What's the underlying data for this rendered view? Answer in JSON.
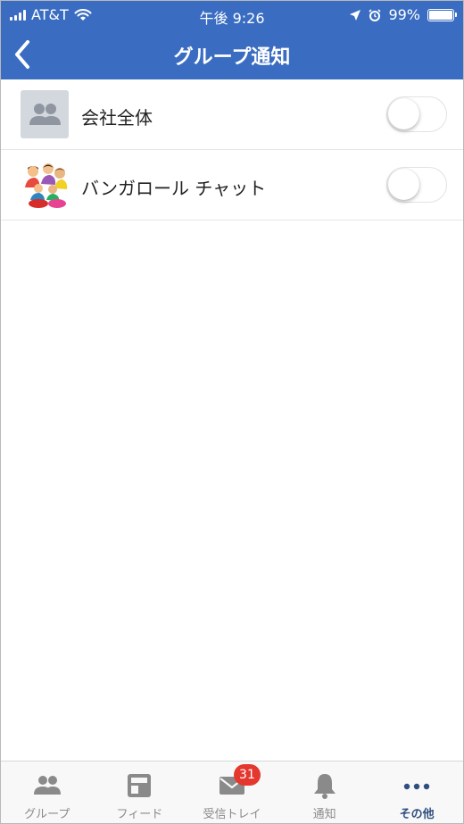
{
  "status_bar": {
    "carrier": "AT&T",
    "time": "午後 9:26",
    "battery_percent": "99%",
    "battery_level": 0.99
  },
  "header": {
    "title": "グループ通知",
    "back_icon": "chevron-left-icon"
  },
  "groups": [
    {
      "name": "会社全体",
      "avatar": "default-group-avatar",
      "notifications_on": false
    },
    {
      "name": "バンガロール チャット",
      "avatar": "people-illustration-avatar",
      "notifications_on": false
    }
  ],
  "tabbar": {
    "tabs": [
      {
        "label": "グループ",
        "icon": "people-icon",
        "active": false
      },
      {
        "label": "フィード",
        "icon": "feed-icon",
        "active": false
      },
      {
        "label": "受信トレイ",
        "icon": "mail-icon",
        "active": false,
        "badge": "31"
      },
      {
        "label": "通知",
        "icon": "bell-icon",
        "active": false
      },
      {
        "label": "その他",
        "icon": "more-icon",
        "active": true
      }
    ]
  },
  "colors": {
    "header_bg": "#3a6dc1",
    "badge": "#e4372d",
    "active_tab": "#2f4f7f",
    "inactive_tab": "#8a8a8a"
  }
}
